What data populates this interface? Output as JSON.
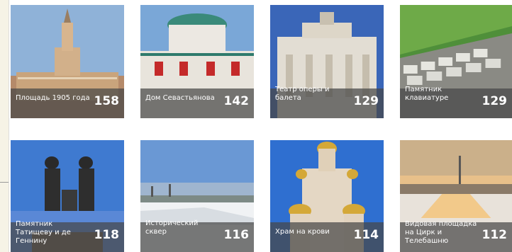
{
  "tiles": [
    {
      "label": "Площадь 1905 года",
      "count": "158",
      "icon": "city-hall-photo"
    },
    {
      "label": "Дом Севастьянова",
      "count": "142",
      "icon": "mansion-photo"
    },
    {
      "label": "Театр оперы и балета",
      "count": "129",
      "icon": "theater-photo"
    },
    {
      "label": "Памятник клавиатуре",
      "count": "129",
      "icon": "keyboard-monument-photo"
    },
    {
      "label": "Памятник Татищеву и де Геннину",
      "count": "118",
      "icon": "statue-photo"
    },
    {
      "label": "Исторический сквер",
      "count": "116",
      "icon": "square-photo"
    },
    {
      "label": "Храм на крови",
      "count": "114",
      "icon": "church-photo"
    },
    {
      "label": "Видовая площадка на Цирк и Телебашню",
      "count": "112",
      "icon": "viewpoint-photo"
    }
  ]
}
